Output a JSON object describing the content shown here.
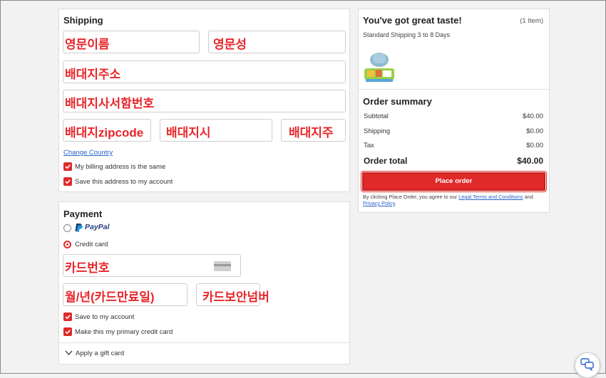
{
  "shipping": {
    "title": "Shipping",
    "first_name": "영문이름",
    "last_name": "영문성",
    "address": "배대지주소",
    "address_detail": "배대지사서함번호",
    "zipcode": "배대지zipcode",
    "city": "배대지시",
    "state": "배대지주",
    "change_country": "Change Country",
    "billing_same_label": "My billing address is the same",
    "save_address_label": "Save this address to my account"
  },
  "payment": {
    "title": "Payment",
    "paypal_label": "PayPal",
    "credit_card_label": "Credit card",
    "card_number": "카드번호",
    "expiry": "월/년(카드만료일)",
    "cvv": "카드보안넘버",
    "save_account_label": "Save to my account",
    "primary_card_label": "Make this my primary credit card",
    "gift_card_label": "Apply a gift card"
  },
  "cart": {
    "title": "You've got great taste!",
    "item_count": "(1 Item)",
    "shipping_note": "Standard Shipping 3 to 8 Days"
  },
  "summary": {
    "title": "Order summary",
    "subtotal_label": "Subtotal",
    "subtotal_value": "$40.00",
    "shipping_label": "Shipping",
    "shipping_value": "$0.00",
    "tax_label": "Tax",
    "tax_value": "$0.00",
    "total_label": "Order total",
    "total_value": "$40.00",
    "place_order_label": "Place order",
    "terms_prefix": "By clicking Place Order, you agree to our",
    "terms_link": "Legal Terms and Conditions",
    "terms_and": "and",
    "privacy_link": "Privacy Policy",
    "terms_suffix": "."
  },
  "colors": {
    "accent": "#e02a2a",
    "link": "#2a62c9",
    "annotation": "#e8262a"
  },
  "icons": [
    "check-icon",
    "paypal-logo-icon",
    "card-icon",
    "chevron-down-icon",
    "chat-icon",
    "product-thumbnail"
  ]
}
